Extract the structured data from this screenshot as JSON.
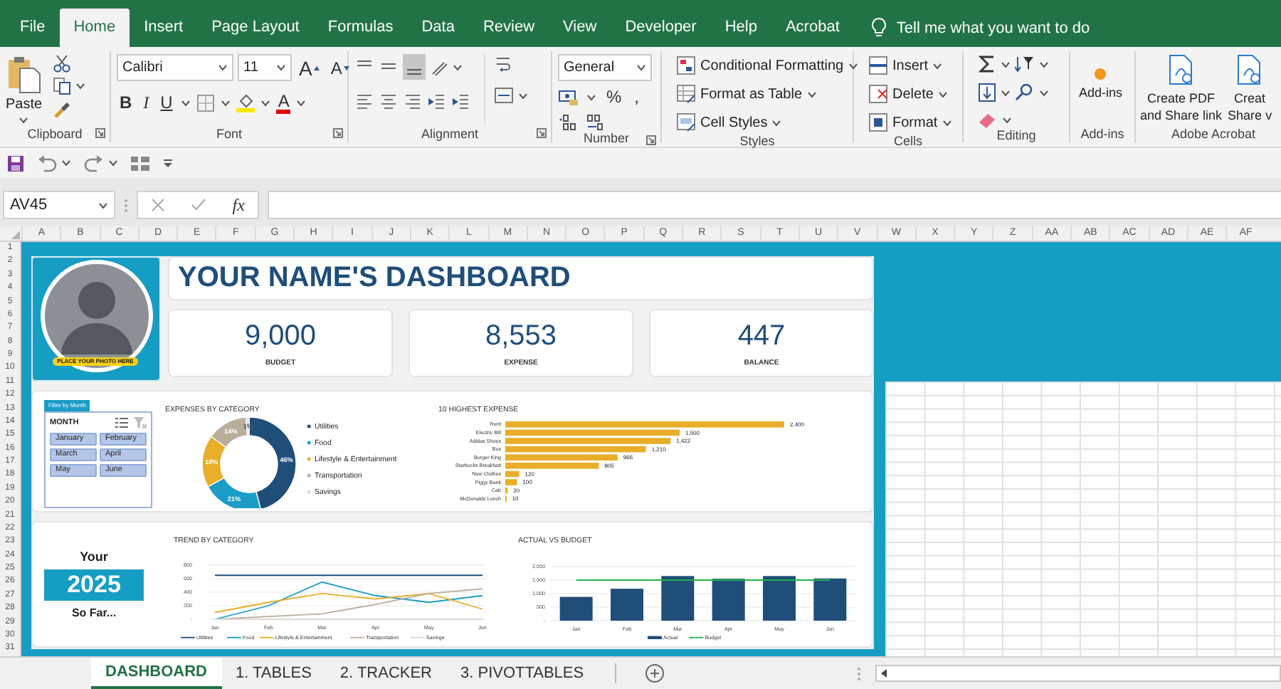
{
  "ribbon_tabs": [
    {
      "label": "File",
      "selected": false
    },
    {
      "label": "Home",
      "selected": true
    },
    {
      "label": "Insert",
      "selected": false
    },
    {
      "label": "Page Layout",
      "selected": false
    },
    {
      "label": "Formulas",
      "selected": false
    },
    {
      "label": "Data",
      "selected": false
    },
    {
      "label": "Review",
      "selected": false
    },
    {
      "label": "View",
      "selected": false
    },
    {
      "label": "Developer",
      "selected": false
    },
    {
      "label": "Help",
      "selected": false
    },
    {
      "label": "Acrobat",
      "selected": false
    }
  ],
  "tell_me": "Tell me what you want to do",
  "clipboard": {
    "paste": "Paste",
    "label": "Clipboard"
  },
  "font": {
    "family": "Calibri",
    "size": "11",
    "grow": "A",
    "shrink": "A",
    "bold": "B",
    "italic": "I",
    "underline": "U",
    "font_color": "A",
    "label": "Font"
  },
  "alignment": {
    "label": "Alignment"
  },
  "number": {
    "format": "General",
    "percent": "%",
    "comma": ",",
    "label": "Number"
  },
  "styles": {
    "items": [
      "Conditional Formatting",
      "Format as Table",
      "Cell Styles"
    ],
    "label": "Styles"
  },
  "cells": {
    "items": [
      "Insert",
      "Delete",
      "Format"
    ],
    "label": "Cells"
  },
  "editing": {
    "label": "Editing"
  },
  "addins": {
    "button": "Add-ins",
    "label": "Add-ins"
  },
  "acrobat": {
    "buttons": [
      [
        "Create PDF",
        "and Share link"
      ],
      [
        "Creat",
        "Share v"
      ]
    ],
    "label": "Adobe Acrobat"
  },
  "name_box": "AV45",
  "function_button": "fx",
  "columns": [
    "A",
    "B",
    "C",
    "D",
    "E",
    "F",
    "G",
    "H",
    "I",
    "J",
    "K",
    "L",
    "M",
    "N",
    "O",
    "P",
    "Q",
    "R",
    "S",
    "T",
    "U",
    "V",
    "W",
    "X",
    "Y",
    "Z",
    "AA",
    "AB",
    "AC",
    "AD",
    "AE",
    "AF"
  ],
  "rows": [
    "1",
    "2",
    "3",
    "4",
    "5",
    "6",
    "7",
    "8",
    "9",
    "10",
    "11",
    "12",
    "13",
    "14",
    "15",
    "16",
    "17",
    "18",
    "19",
    "20",
    "21",
    "22",
    "23",
    "24",
    "25",
    "26",
    "27",
    "28",
    "29",
    "30",
    "31"
  ],
  "dashboard": {
    "photo_caption": "PLACE YOUR PHOTO HERE",
    "title": "YOUR NAME'S DASHBOARD",
    "kpis": [
      {
        "value": "9,000",
        "label": "BUDGET"
      },
      {
        "value": "8,553",
        "label": "EXPENSE"
      },
      {
        "value": "447",
        "label": "BALANCE"
      }
    ],
    "slicer": {
      "caption": "Filter by Month",
      "title": "MONTH",
      "items": [
        {
          "label": "January",
          "selected": true
        },
        {
          "label": "February",
          "selected": true
        },
        {
          "label": "March",
          "selected": true
        },
        {
          "label": "April",
          "selected": true
        },
        {
          "label": "May",
          "selected": true
        },
        {
          "label": "June",
          "selected": true
        }
      ]
    },
    "expenses_by_category": {
      "chart_data": {
        "type": "donut",
        "title": "EXPENSES BY CATEGORY",
        "categories": [
          "Utilities",
          "Food",
          "Lifestyle & Entertainment",
          "Transportation",
          "Savings"
        ],
        "values": [
          46,
          21,
          18,
          14,
          1
        ],
        "value_labels": [
          "46%",
          "21%",
          "18%",
          "14%",
          "1%"
        ],
        "legend": "right",
        "colors": [
          "#1f4e79",
          "#1a9cc7",
          "#e8ae2a",
          "#b9ad9c",
          "#dcdcdc"
        ]
      }
    },
    "highest_expense": {
      "chart_data": {
        "type": "bar",
        "orientation": "horizontal",
        "title": "10 HIGHEST EXPENSE",
        "categories": [
          "Rent",
          "Electric Bill",
          "Adidas Shoes",
          "Bus",
          "Burger King",
          "Starbucks Breakfast",
          "New Clothes",
          "Piggy Bank",
          "Cab",
          "McDonalds Lunch"
        ],
        "series": [
          {
            "color": "#e8ae2a",
            "values": [
              2400,
              1500,
              1422,
              1210,
              966,
              805,
              120,
              100,
              20,
              10
            ],
            "value_labels": [
              "2,400",
              "1,500",
              "1,422",
              "1,210",
              "966",
              "805",
              "120",
              "100",
              "20",
              "10"
            ]
          }
        ],
        "data_labels": true
      }
    },
    "year_box": {
      "top": "Your",
      "year": "2025",
      "bottom": "So Far..."
    },
    "trend": {
      "chart_data": {
        "type": "line",
        "title": "TREND BY CATEGORY",
        "legend": "bottom",
        "grid": true,
        "categories": [
          "Jan",
          "Feb",
          "Mar",
          "Apr",
          "May",
          "Jun"
        ],
        "ylim": [
          0,
          800
        ],
        "yticks": [
          {
            "value": 0,
            "label": "-"
          },
          200,
          400,
          600,
          800
        ],
        "series": [
          {
            "name": "Utilities",
            "color": "#1f4e79",
            "values": [
              650,
              650,
              650,
              650,
              650,
              650
            ]
          },
          {
            "name": "Food",
            "color": "#1a9cc7",
            "values": [
              0,
              200,
              550,
              350,
              250,
              350
            ]
          },
          {
            "name": "Lifestyle & Entertainment",
            "color": "#e8ae2a",
            "values": [
              100,
              250,
              380,
              300,
              380,
              150
            ]
          },
          {
            "name": "Transportation",
            "color": "#b9ad9c",
            "values": [
              0,
              40,
              80,
              220,
              380,
              450
            ]
          },
          {
            "name": "Savings",
            "color": "#d9d9d9",
            "values": [
              0,
              0,
              0,
              0,
              0,
              0
            ]
          }
        ]
      }
    },
    "actual_vs_budget": {
      "chart_data": {
        "type": "bar",
        "title": "ACTUAL VS BUDGET",
        "legend": "bottom",
        "grid": true,
        "categories": [
          "Jan",
          "Feb",
          "Mar",
          "Apr",
          "May",
          "Jun"
        ],
        "ylim": [
          0,
          2000
        ],
        "yticks": [
          {
            "value": 0,
            "label": "-"
          },
          {
            "value": 500,
            "label": "500"
          },
          {
            "value": 1000,
            "label": "1,000"
          },
          {
            "value": 1500,
            "label": "1,500"
          },
          {
            "value": 2000,
            "label": "2,000"
          }
        ],
        "series": [
          {
            "name": "Actual",
            "type": "bar",
            "color": "#1f4e79",
            "values": [
              880,
              1180,
              1650,
              1550,
              1650,
              1560
            ]
          },
          {
            "name": "Budget",
            "type": "line",
            "color": "#22b04b",
            "values": [
              1500,
              1500,
              1500,
              1500,
              1500,
              1500
            ]
          }
        ]
      }
    }
  },
  "sheet_tabs": [
    {
      "label": "DASHBOARD",
      "selected": true
    },
    {
      "label": "1. TABLES",
      "selected": false
    },
    {
      "label": "2. TRACKER",
      "selected": false
    },
    {
      "label": "3. PIVOTTABLES",
      "selected": false
    }
  ]
}
